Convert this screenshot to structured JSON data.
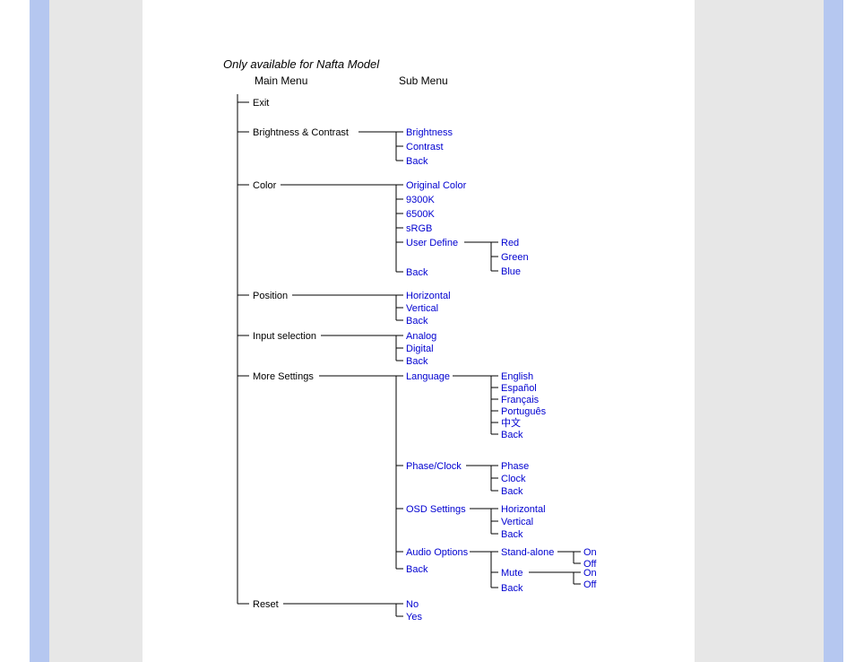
{
  "title": "Only available for Nafta Model",
  "headers": {
    "main": "Main Menu",
    "sub": "Sub Menu"
  },
  "menu": {
    "exit": "Exit",
    "bc": {
      "label": "Brightness & Contrast",
      "items": [
        "Brightness",
        "Contrast",
        "Back"
      ]
    },
    "color": {
      "label": "Color",
      "items": [
        "Original Color",
        "9300K",
        "6500K",
        "sRGB",
        "User Define",
        "Back"
      ],
      "userDefine": [
        "Red",
        "Green",
        "Blue"
      ]
    },
    "position": {
      "label": "Position",
      "items": [
        "Horizontal",
        "Vertical",
        "Back"
      ]
    },
    "input": {
      "label": "Input selection",
      "items": [
        "Analog",
        "Digital",
        "Back"
      ]
    },
    "more": {
      "label": "More Settings",
      "language": {
        "label": "Language",
        "items": [
          "English",
          "Español",
          "Français",
          "Português",
          "中文",
          "Back"
        ]
      },
      "phase": {
        "label": "Phase/Clock",
        "items": [
          "Phase",
          "Clock",
          "Back"
        ]
      },
      "osd": {
        "label": "OSD Settings",
        "items": [
          "Horizontal",
          "Vertical",
          "Back"
        ]
      },
      "audio": {
        "label": "Audio Options",
        "standalone": {
          "label": "Stand-alone",
          "items": [
            "On",
            "Off"
          ]
        },
        "mute": {
          "label": "Mute",
          "items": [
            "On",
            "Off"
          ]
        },
        "back": "Back"
      },
      "back": "Back"
    },
    "reset": {
      "label": "Reset",
      "items": [
        "No",
        "Yes"
      ]
    }
  }
}
